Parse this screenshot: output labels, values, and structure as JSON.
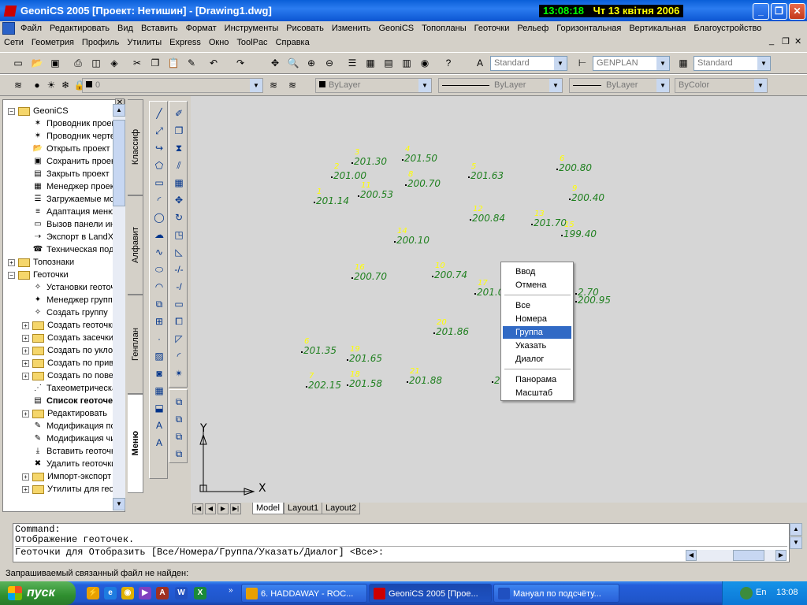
{
  "window": {
    "title": "GeoniCS 2005 [Проект: Нетишин] - [Drawing1.dwg]",
    "clock_time": "13:08:18",
    "clock_date": "Чт 13 квітня 2006",
    "minimize_label": "_",
    "maximize_label": "❐",
    "close_label": "✕"
  },
  "menu1": [
    "Файл",
    "Редактировать",
    "Вид",
    "Вставить",
    "Формат",
    "Инструменты",
    "Рисовать",
    "Изменить",
    "GeoniCS",
    "Топопланы",
    "Геоточки",
    "Рельеф",
    "Горизонтальная",
    "Вертикальная",
    "Благоустройство"
  ],
  "menu2": [
    "Сети",
    "Геометрия",
    "Профиль",
    "Утилиты",
    "Express",
    "Окно",
    "ToolPac",
    "Справка"
  ],
  "doc_controls": [
    "_",
    "❐",
    "✕"
  ],
  "toolbar1": {
    "text_style": "Standard",
    "dim_style": "GENPLAN",
    "table_style": "Standard"
  },
  "toolbar2": {
    "layer": "0",
    "color": "ByLayer",
    "linetype": "ByLayer",
    "lineweight": "ByLayer",
    "plotstyle": "ByColor"
  },
  "tree": [
    {
      "label": "GeoniCS",
      "level": 0,
      "type": "folder",
      "pm": "−",
      "bold": false
    },
    {
      "label": "Проводник проекта",
      "level": 1,
      "type": "item",
      "icon": "explorer-icon"
    },
    {
      "label": "Проводник чертежа",
      "level": 1,
      "type": "item",
      "icon": "explorer-icon"
    },
    {
      "label": "Открыть проект",
      "level": 1,
      "type": "item",
      "icon": "open-icon"
    },
    {
      "label": "Сохранить проект",
      "level": 1,
      "type": "item",
      "icon": "save-icon"
    },
    {
      "label": "Закрыть проект",
      "level": 1,
      "type": "item",
      "icon": "close-project-icon"
    },
    {
      "label": "Менеджер проектов",
      "level": 1,
      "type": "item",
      "icon": "manager-icon"
    },
    {
      "label": "Загружаемые модули",
      "level": 1,
      "type": "item",
      "icon": "modules-icon"
    },
    {
      "label": "Адаптация меню",
      "level": 1,
      "type": "item",
      "icon": "adapt-icon"
    },
    {
      "label": "Вызов панели инструментов",
      "level": 1,
      "type": "item",
      "icon": "panel-icon"
    },
    {
      "label": "Экспорт в LandXML",
      "level": 1,
      "type": "item",
      "icon": "export-icon"
    },
    {
      "label": "Техническая поддержка",
      "level": 1,
      "type": "item",
      "icon": "support-icon"
    },
    {
      "label": "Топознаки",
      "level": 0,
      "type": "folder",
      "pm": "+"
    },
    {
      "label": "Геоточки",
      "level": 0,
      "type": "folder",
      "pm": "−"
    },
    {
      "label": "Установки геоточек",
      "level": 1,
      "type": "item",
      "icon": "settings-icon"
    },
    {
      "label": "Менеджер групп",
      "level": 1,
      "type": "item",
      "icon": "group-manager-icon"
    },
    {
      "label": "Создать группу",
      "level": 1,
      "type": "item",
      "icon": "create-group-icon"
    },
    {
      "label": "Создать геоточки",
      "level": 1,
      "type": "folder",
      "pm": "+"
    },
    {
      "label": "Создать засечки",
      "level": 1,
      "type": "folder",
      "pm": "+"
    },
    {
      "label": "Создать по уклону",
      "level": 1,
      "type": "folder",
      "pm": "+"
    },
    {
      "label": "Создать по привязке",
      "level": 1,
      "type": "folder",
      "pm": "+"
    },
    {
      "label": "Создать по поверхности",
      "level": 1,
      "type": "folder",
      "pm": "+"
    },
    {
      "label": "Тахеометрическая съемка",
      "level": 1,
      "type": "item",
      "icon": "tacheometry-icon"
    },
    {
      "label": "Список геоточек",
      "level": 1,
      "type": "item",
      "icon": "list-icon",
      "bold": true
    },
    {
      "label": "Редактировать",
      "level": 1,
      "type": "folder",
      "pm": "+"
    },
    {
      "label": "Модификация по",
      "level": 1,
      "type": "item",
      "icon": "modify-icon"
    },
    {
      "label": "Модификация числа",
      "level": 1,
      "type": "item",
      "icon": "modify-icon"
    },
    {
      "label": "Вставить геоточки",
      "level": 1,
      "type": "item",
      "icon": "insert-icon"
    },
    {
      "label": "Удалить геоточки",
      "level": 1,
      "type": "item",
      "icon": "delete-icon"
    },
    {
      "label": "Импорт-экспорт",
      "level": 1,
      "type": "folder",
      "pm": "+"
    },
    {
      "label": "Утилиты для геоточек",
      "level": 1,
      "type": "folder",
      "pm": "+"
    }
  ],
  "vtabs": [
    "Классиф",
    "Алфавит",
    "Генплан",
    "Меню"
  ],
  "points": [
    {
      "num": "3",
      "val": "201.30"
    },
    {
      "num": "4",
      "val": "201.50"
    },
    {
      "num": "2",
      "val": "201.00"
    },
    {
      "num": "8",
      "val": "200.70"
    },
    {
      "num": "5",
      "val": "201.63"
    },
    {
      "num": "6",
      "val": "200.80"
    },
    {
      "num": "1",
      "val": "201.14"
    },
    {
      "num": "11",
      "val": "200.53"
    },
    {
      "num": "9",
      "val": "200.40"
    },
    {
      "num": "12",
      "val": "200.84"
    },
    {
      "num": "13",
      "val": "201.70"
    },
    {
      "num": "15",
      "val": "199.40"
    },
    {
      "num": "14",
      "val": "200.10"
    },
    {
      "num": "16",
      "val": "200.70"
    },
    {
      "num": "10",
      "val": "200.74"
    },
    {
      "num": "17",
      "val": "201.0"
    },
    {
      "num": "",
      "val": "2.70"
    },
    {
      "num": "",
      "val": "200.95"
    },
    {
      "num": "20",
      "val": "201.86"
    },
    {
      "num": "6",
      "val": "201.35"
    },
    {
      "num": "19",
      "val": "201.65"
    },
    {
      "num": "7",
      "val": "202.15"
    },
    {
      "num": "18",
      "val": "201.58"
    },
    {
      "num": "21",
      "val": "201.88"
    },
    {
      "num": "",
      "val": "20"
    },
    {
      "num": "",
      "val": "9"
    }
  ],
  "ucs": {
    "x_label": "X",
    "y_label": "Y"
  },
  "layout_tabs": [
    "Model",
    "Layout1",
    "Layout2"
  ],
  "context_menu": {
    "items": [
      "Ввод",
      "Отмена",
      "Все",
      "Номера",
      "Группа",
      "Указать",
      "Диалог",
      "Панорама",
      "Масштаб"
    ],
    "selected": "Группа"
  },
  "command": {
    "line1": "Command:",
    "line2": "Отображение геоточек.",
    "prompt": "Геоточки для Отобразить [Все/Номера/Группа/Указать/Диалог] <Все>:"
  },
  "status": "Запрашиваемый связанный файл не найден:",
  "taskbar": {
    "start_label": "пуск",
    "tasks": [
      "6. HADDAWAY - ROC...",
      "GeoniCS 2005 [Прое...",
      "Мануал по подсчёту..."
    ],
    "lang1": "EN",
    "lang2": "En",
    "time": "13:08"
  },
  "colors": {
    "point_number": "#ffff00",
    "point_value": "#208020",
    "canvas": "#d6d6d6",
    "selection": "#316ac5"
  }
}
